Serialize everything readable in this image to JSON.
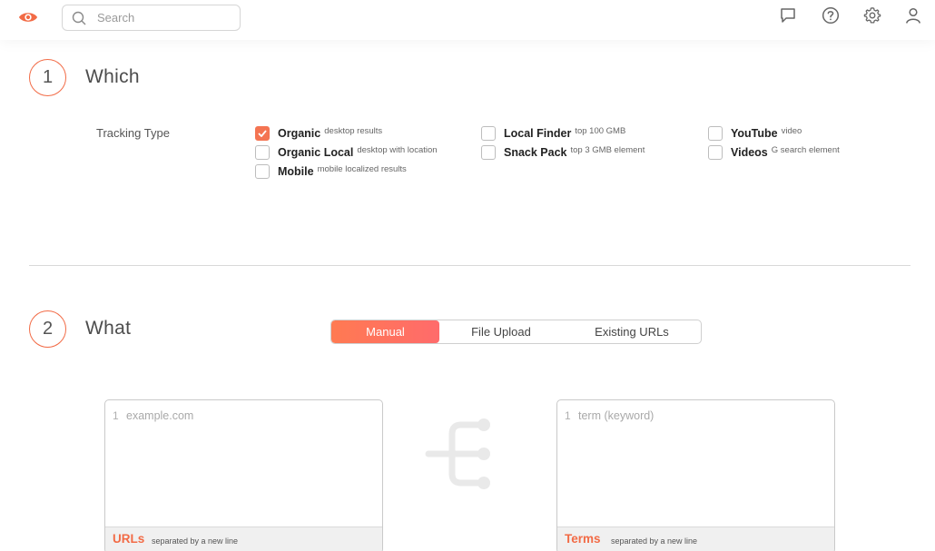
{
  "header": {
    "logo_icon": "eye-icon",
    "search_placeholder": "Search",
    "icons": [
      "chat-icon",
      "help-icon",
      "gear-icon",
      "user-icon"
    ]
  },
  "section1": {
    "number": "1",
    "title": "Which",
    "tracking_label": "Tracking Type",
    "options": [
      {
        "name": "Organic",
        "desc": "desktop results",
        "checked": true
      },
      {
        "name": "Organic Local",
        "desc": "desktop with location",
        "checked": false
      },
      {
        "name": "Mobile",
        "desc": "mobile localized results",
        "checked": false
      },
      {
        "name": "Local Finder",
        "desc": "top 100 GMB",
        "checked": false
      },
      {
        "name": "Snack Pack",
        "desc": "top 3 GMB element",
        "checked": false
      },
      {
        "name": "YouTube",
        "desc": "video",
        "checked": false
      },
      {
        "name": "Videos",
        "desc": "G search element",
        "checked": false
      }
    ]
  },
  "section2": {
    "number": "2",
    "title": "What",
    "tabs": [
      "Manual",
      "File Upload",
      "Existing URLs"
    ],
    "active_tab": "Manual",
    "urls_box": {
      "line_number": "1",
      "placeholder": "example.com",
      "footer_title": "URLs",
      "footer_note": "separated by a new line"
    },
    "terms_box": {
      "line_number": "1",
      "placeholder": "term (keyword)",
      "footer_title": "Terms",
      "footer_note": "separated by a new line"
    }
  },
  "colors": {
    "accent": "#f26b46",
    "checkbox_checked": "#f47452",
    "tab_active_gradient_start": "#ff7a52",
    "tab_active_gradient_end": "#ff6b6b"
  }
}
